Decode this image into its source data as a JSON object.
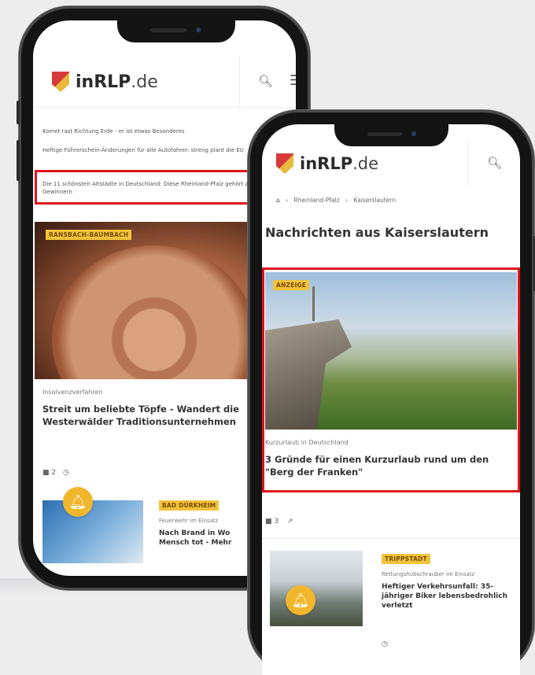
{
  "back_phone": {
    "logo_main": "inRLP",
    "logo_tld": ".de",
    "teasers": [
      "Komet rast Richtung Erde - er ist etwas Besonderes",
      "Heftige Führerschein-Änderungen für alle Autofahrer: streng plant die EU",
      "Die 11 schönsten Altstädte in Deutschland: Diese Rheinland-Pfalz gehört zu den Gewinnern"
    ],
    "article1": {
      "badge": "RANSBACH-BAUMBACH",
      "category": "Insolvenzverfahren",
      "headline": "Streit um beliebte Töpfe - Wandert die Westerwälder Traditionsunternehmen",
      "meta_count": "2"
    },
    "article2": {
      "badge": "BAD DÜRKHEIM",
      "category": "Feuerwehr im Einsatz",
      "headline": "Nach Brand in Wo Mensch tot - Mehr"
    }
  },
  "front_phone": {
    "logo_main": "inRLP",
    "logo_tld": ".de",
    "breadcrumb": [
      "Rheinland-Pfalz",
      "Kaiserslautern"
    ],
    "page_title": "Nachrichten aus Kaiserslautern",
    "featured": {
      "badge": "ANZEIGE",
      "category": "Kurzurlaub in Deutschland",
      "headline": "3 Gründe für einen Kurzurlaub rund um den \"Berg der Franken\"",
      "meta_count": "3"
    },
    "article2": {
      "badge": "TRIPPSTADT",
      "category": "Rettungshubschrauber im Einsatz",
      "headline": "Heftiger Verkehrsunfall: 35-jähriger Biker lebensbedrohlich verletzt"
    }
  },
  "colors": {
    "highlight": "#e0121b",
    "badge": "#f1c33c",
    "bell": "#f1b72c"
  }
}
